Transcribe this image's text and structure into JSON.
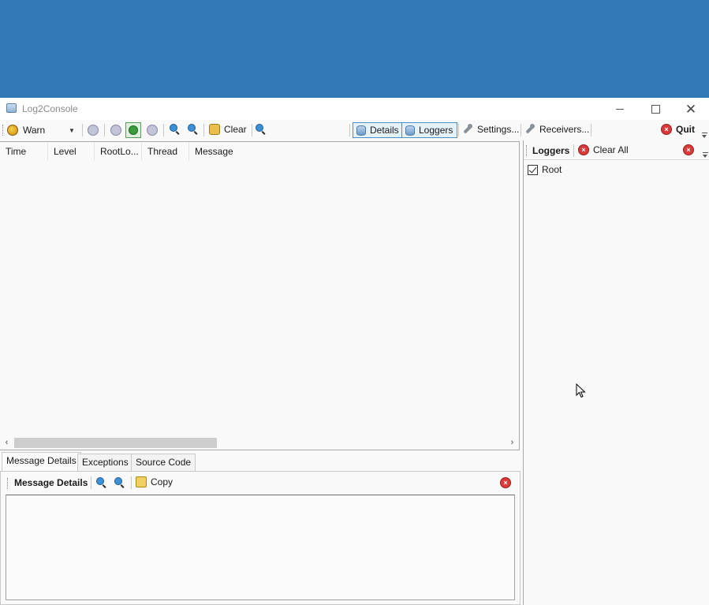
{
  "app": {
    "title": "Log2Console"
  },
  "toolbar": {
    "level": "Warn",
    "clear_label": "Clear",
    "details_label": "Details",
    "loggers_label": "Loggers",
    "settings_label": "Settings...",
    "receivers_label": "Receivers...",
    "quit_label": "Quit"
  },
  "grid": {
    "columns": [
      "Time",
      "Level",
      "RootLo...",
      "Thread",
      "Message"
    ]
  },
  "tabs": [
    "Message Details",
    "Exceptions",
    "Source Code"
  ],
  "details": {
    "title": "Message Details",
    "copy_label": "Copy"
  },
  "loggers": {
    "title": "Loggers",
    "clear_all_label": "Clear All",
    "items": [
      "Root"
    ]
  },
  "colors": {
    "desktop": "#3379b5",
    "window": "#f9f9f9",
    "accent": "#4a90c8",
    "danger": "#d93a3a"
  }
}
